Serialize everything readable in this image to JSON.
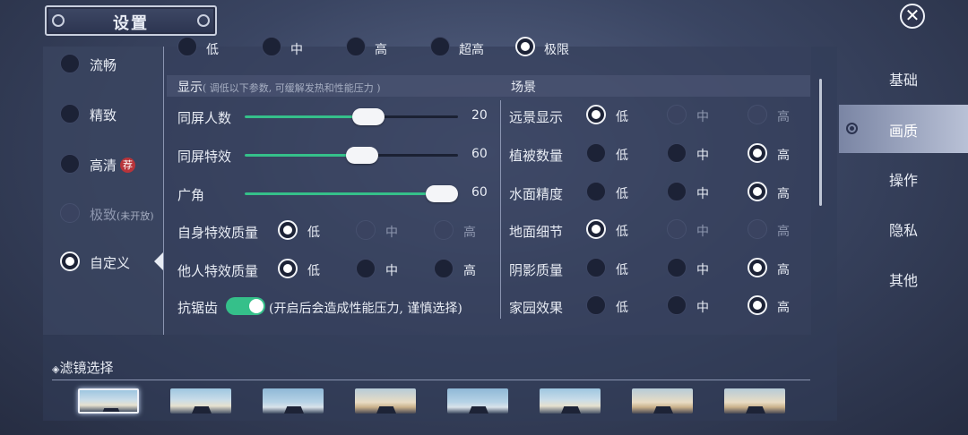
{
  "header": {
    "title": "设置"
  },
  "close_label": "✕",
  "tabs": [
    {
      "label": "基础",
      "active": false
    },
    {
      "label": "画质",
      "active": true
    },
    {
      "label": "操作",
      "active": false
    },
    {
      "label": "隐私",
      "active": false
    },
    {
      "label": "其他",
      "active": false
    }
  ],
  "presets": {
    "items": [
      {
        "label": "流畅",
        "selected": false,
        "disabled": false
      },
      {
        "label": "精致",
        "selected": false,
        "disabled": false
      },
      {
        "label": "高清",
        "badge": "荐",
        "selected": false,
        "disabled": false
      },
      {
        "label": "极致",
        "note": "(未开放)",
        "selected": false,
        "disabled": true
      },
      {
        "label": "自定义",
        "selected": true,
        "disabled": false
      }
    ]
  },
  "frame_row": {
    "options": [
      "低",
      "中",
      "高",
      "超高",
      "极限"
    ],
    "selected": "极限"
  },
  "display": {
    "title": "显示",
    "hint": "( 调低以下参数, 可缓解发热和性能压力 )",
    "sliders": [
      {
        "label": "同屏人数",
        "value": "20",
        "fraction": 0.58
      },
      {
        "label": "同屏特效",
        "value": "60",
        "fraction": 0.55
      },
      {
        "label": "广角",
        "value": "60",
        "fraction": 0.93
      }
    ],
    "quality_rows": [
      {
        "label": "自身特效质量",
        "options": [
          "低",
          "中",
          "高"
        ],
        "selected": "低",
        "disabled": [
          "中",
          "高"
        ]
      },
      {
        "label": "他人特效质量",
        "options": [
          "低",
          "中",
          "高"
        ],
        "selected": "低",
        "disabled": []
      }
    ],
    "antialias": {
      "label": "抗锯齿",
      "on": true,
      "note": "(开启后会造成性能压力, 谨慎选择)"
    }
  },
  "scene": {
    "title": "场景",
    "rows": [
      {
        "label": "远景显示",
        "options": [
          "低",
          "中",
          "高"
        ],
        "selected": "低",
        "disabled": [
          "中",
          "高"
        ]
      },
      {
        "label": "植被数量",
        "options": [
          "低",
          "中",
          "高"
        ],
        "selected": "高",
        "disabled": []
      },
      {
        "label": "水面精度",
        "options": [
          "低",
          "中",
          "高"
        ],
        "selected": "高",
        "disabled": []
      },
      {
        "label": "地面细节",
        "options": [
          "低",
          "中",
          "高"
        ],
        "selected": "低",
        "disabled": [
          "中",
          "高"
        ]
      },
      {
        "label": "阴影质量",
        "options": [
          "低",
          "中",
          "高"
        ],
        "selected": "高",
        "disabled": []
      },
      {
        "label": "家园效果",
        "options": [
          "低",
          "中",
          "高"
        ],
        "selected": "高",
        "disabled": []
      }
    ]
  },
  "filter": {
    "title": "滤镜选择",
    "count": 8,
    "selected_index": 0
  },
  "colors": {
    "accent_green": "#35c08a",
    "badge_red": "#b8343a"
  }
}
